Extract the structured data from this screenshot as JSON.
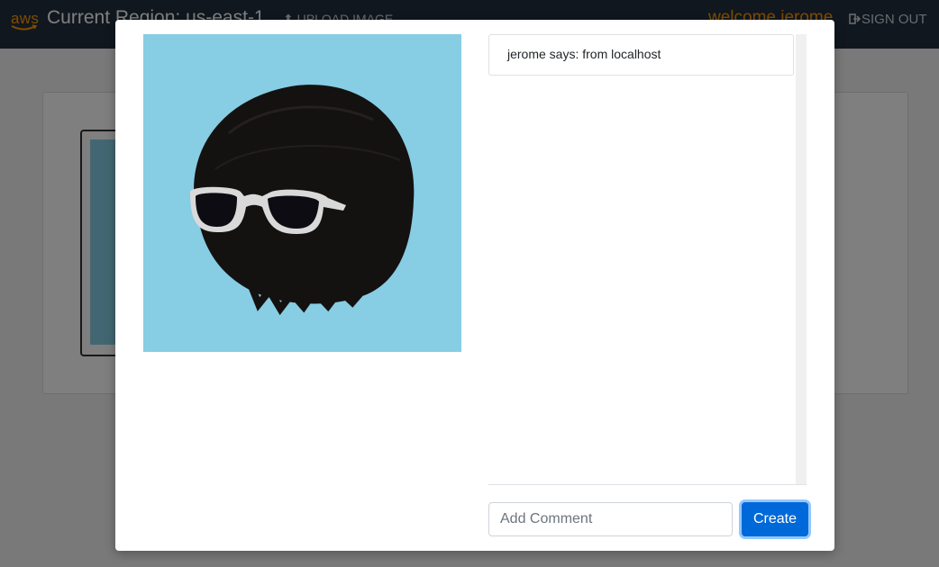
{
  "navbar": {
    "logo_text": "aws",
    "region_label": "Current Region: us-east-1",
    "upload_label": "UPLOAD IMAGE",
    "welcome_label": "welcome jerome",
    "signout_label": "SIGN OUT"
  },
  "modal": {
    "comments": [
      {
        "text": "jerome says: from localhost"
      }
    ],
    "comment_input": {
      "placeholder": "Add Comment",
      "value": ""
    },
    "create_label": "Create"
  },
  "colors": {
    "navbar": "#232f3e",
    "brand": "#ff9900",
    "primary": "#0069d9",
    "photo_bg": "#87cde4"
  }
}
